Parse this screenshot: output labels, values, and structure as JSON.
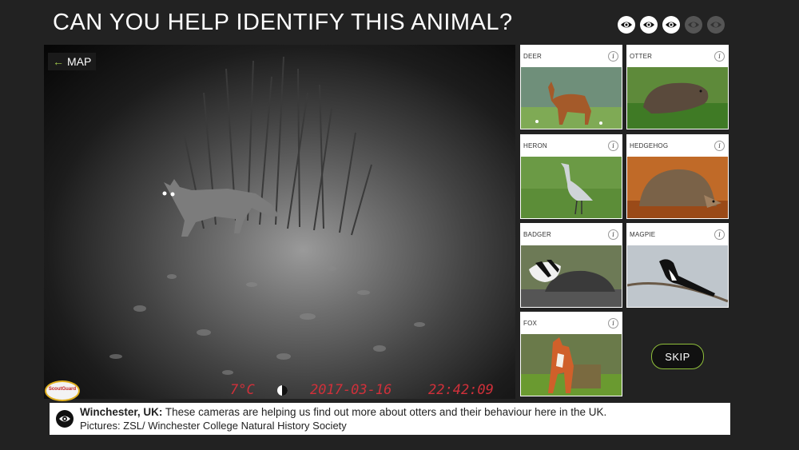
{
  "header": {
    "title": "CAN YOU HELP IDENTIFY THIS ANIMAL?",
    "progress": [
      {
        "state": "done",
        "icon": "eye-icon"
      },
      {
        "state": "done",
        "icon": "eye-icon"
      },
      {
        "state": "done",
        "icon": "eye-icon"
      },
      {
        "state": "todo",
        "icon": "eye-icon"
      },
      {
        "state": "todo",
        "icon": "eye-icon"
      }
    ]
  },
  "camera": {
    "back_arrow": "←",
    "back_label": "MAP",
    "logo_text": "ScoutGuard",
    "osd_temp": "7°C",
    "osd_date": "2017-03-16",
    "osd_time": "22:42:09"
  },
  "options": [
    {
      "label": "DEER",
      "info": "i"
    },
    {
      "label": "OTTER",
      "info": "i"
    },
    {
      "label": "HERON",
      "info": "i"
    },
    {
      "label": "HEDGEHOG",
      "info": "i"
    },
    {
      "label": "BADGER",
      "info": "i"
    },
    {
      "label": "MAGPIE",
      "info": "i"
    },
    {
      "label": "FOX",
      "info": "i"
    }
  ],
  "skip_label": "SKIP",
  "caption": {
    "location": "Winchester, UK:",
    "text": " These cameras are helping us find out more about otters and their behaviour here in the UK.",
    "credits": "Pictures: ZSL/ Winchester College Natural History Society"
  },
  "colors": {
    "background": "#222222",
    "accent": "#8fbf3a",
    "osd_red": "#d0303a"
  }
}
